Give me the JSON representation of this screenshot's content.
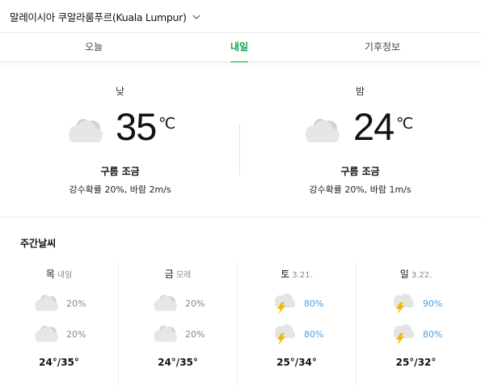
{
  "header": {
    "location": "말레이시아 쿠알라룸푸르(Kuala Lumpur)"
  },
  "tabs": [
    {
      "label": "오늘"
    },
    {
      "label": "내일",
      "selected": true
    },
    {
      "label": "기후정보"
    }
  ],
  "tomorrow": {
    "day": {
      "period": "낮",
      "temp": "35",
      "unit": "℃",
      "condition": "구름 조금",
      "detail": "강수확률 20%, 바람 2m/s",
      "icon": "cloud-icon"
    },
    "night": {
      "period": "밤",
      "temp": "24",
      "unit": "℃",
      "condition": "구름 조금",
      "detail": "강수확률 20%, 바람 1m/s",
      "icon": "cloud-icon"
    }
  },
  "weekly": {
    "title": "주간날씨",
    "days": [
      {
        "name": "목",
        "sub": "내일",
        "am_icon": "cloud-icon",
        "am_pct": "20%",
        "pm_icon": "cloud-icon",
        "pm_pct": "20%",
        "range": "24°/35°"
      },
      {
        "name": "금",
        "sub": "모레",
        "am_icon": "cloud-icon",
        "am_pct": "20%",
        "pm_icon": "cloud-icon",
        "pm_pct": "20%",
        "range": "24°/35°"
      },
      {
        "name": "토",
        "sub": "3.21.",
        "am_icon": "thunderstorm-icon",
        "am_pct": "80%",
        "pm_icon": "thunderstorm-icon",
        "pm_pct": "80%",
        "range": "25°/34°"
      },
      {
        "name": "일",
        "sub": "3.22.",
        "am_icon": "thunderstorm-icon",
        "am_pct": "90%",
        "pm_icon": "thunderstorm-icon",
        "pm_pct": "80%",
        "range": "25°/32°"
      }
    ]
  },
  "colors": {
    "accent": "#03a94d",
    "rain": "#4a9fe0",
    "bolt": "#f2b705",
    "cloud": "#e2e2e2"
  }
}
